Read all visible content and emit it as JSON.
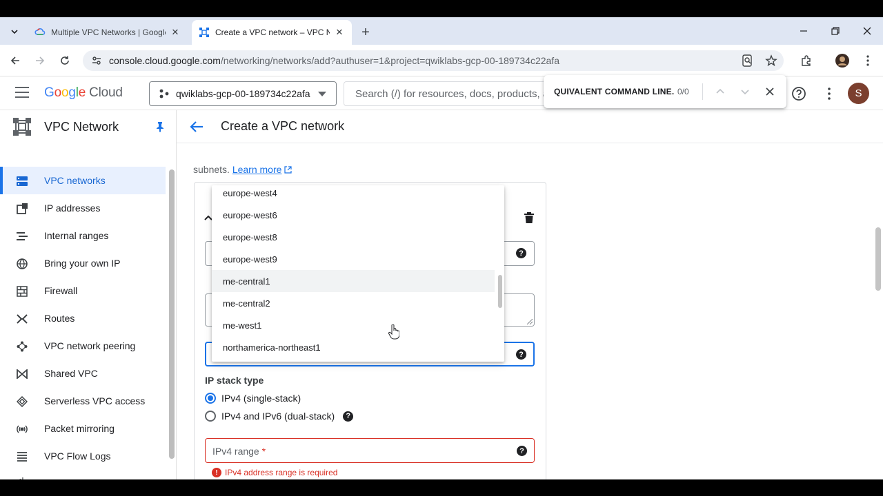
{
  "browser": {
    "tabs": [
      {
        "title": "Multiple VPC Networks | Google",
        "active": false
      },
      {
        "title": "Create a VPC network – VPC Ne",
        "active": true
      }
    ],
    "url_host": "console.cloud.google.com",
    "url_path": "/networking/networks/add?authuser=1&project=qwiklabs-gcp-00-189734c22afa"
  },
  "find_bar": {
    "query": "QUIVALENT COMMAND LINE.",
    "count": "0/0"
  },
  "header": {
    "logo_google": "Google",
    "logo_cloud": "Cloud",
    "project": "qwiklabs-gcp-00-189734c22afa",
    "search_placeholder": "Search (/) for resources, docs, products, and more",
    "avatar_letter": "S"
  },
  "sidebar": {
    "title": "VPC Network",
    "items": [
      {
        "label": "VPC networks",
        "icon": "vpc-networks-icon",
        "active": true
      },
      {
        "label": "IP addresses",
        "icon": "ip-addresses-icon"
      },
      {
        "label": "Internal ranges",
        "icon": "internal-ranges-icon"
      },
      {
        "label": "Bring your own IP",
        "icon": "globe-icon"
      },
      {
        "label": "Firewall",
        "icon": "firewall-icon"
      },
      {
        "label": "Routes",
        "icon": "routes-icon"
      },
      {
        "label": "VPC network peering",
        "icon": "peering-icon"
      },
      {
        "label": "Shared VPC",
        "icon": "shared-vpc-icon"
      },
      {
        "label": "Serverless VPC access",
        "icon": "serverless-icon"
      },
      {
        "label": "Packet mirroring",
        "icon": "packet-mirroring-icon"
      },
      {
        "label": "VPC Flow Logs",
        "icon": "flow-logs-icon"
      }
    ],
    "collapse_glyph": "<|"
  },
  "page": {
    "title": "Create a VPC network",
    "subnets_text": "subnets.",
    "learn_more": "Learn more"
  },
  "region_dropdown": {
    "options": [
      "europe-west4",
      "europe-west6",
      "europe-west8",
      "europe-west9",
      "me-central1",
      "me-central2",
      "me-west1",
      "northamerica-northeast1"
    ],
    "hovered": "me-central1"
  },
  "form": {
    "ip_stack_label": "IP stack type",
    "ip_stack_options": [
      {
        "label": "IPv4 (single-stack)",
        "checked": true
      },
      {
        "label": "IPv4 and IPv6 (dual-stack)",
        "checked": false
      }
    ],
    "ipv4_range_label": "IPv4 range",
    "required_mark": "*",
    "ipv4_error": "IPv4 address range is required",
    "help_glyph": "?"
  },
  "colors": {
    "accent": "#1a73e8",
    "error": "#d93025",
    "active_nav_bg": "#e8f0fe"
  }
}
